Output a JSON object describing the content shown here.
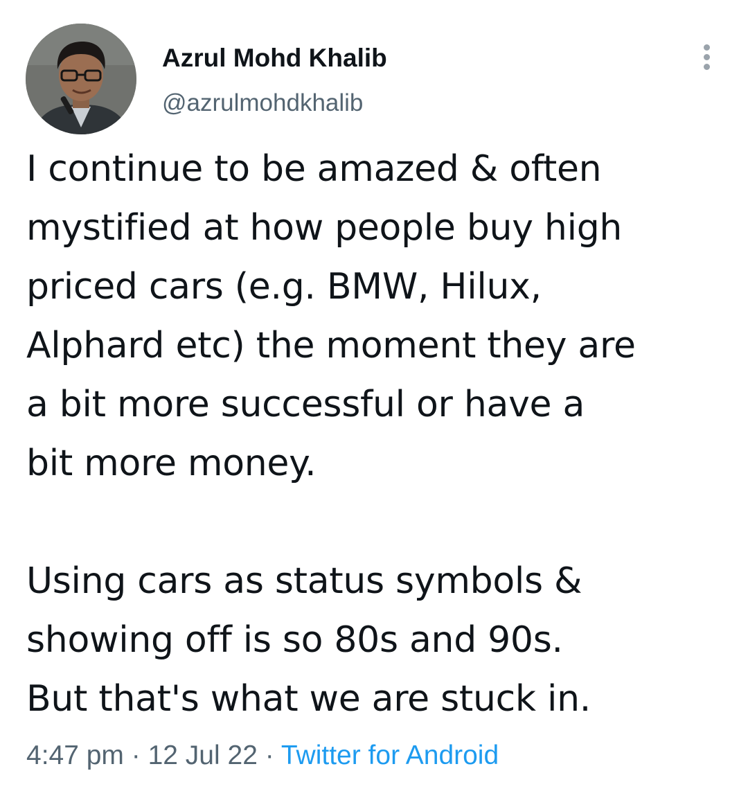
{
  "author": {
    "display_name": "Azrul Mohd Khalib",
    "handle": "@azrulmohdkhalib",
    "avatar_icon": "profile-photo"
  },
  "more_icon": "more-vertical-icon",
  "tweet": {
    "paragraph_1": "I continue to be amazed & often\nmystified at how people buy high\npriced cars (e.g. BMW, Hilux,\nAlphard etc) the moment they are\na bit more successful or have a\nbit more money.",
    "paragraph_2": "Using cars as status symbols &\nshowing off is so 80s and 90s.\nBut that's what we are stuck in."
  },
  "meta": {
    "time": "4:47 pm",
    "separator": " · ",
    "date": "12 Jul 22",
    "source": "Twitter for Android"
  },
  "colors": {
    "text": "#0f1419",
    "secondary": "#536471",
    "link": "#1d9bf0"
  }
}
